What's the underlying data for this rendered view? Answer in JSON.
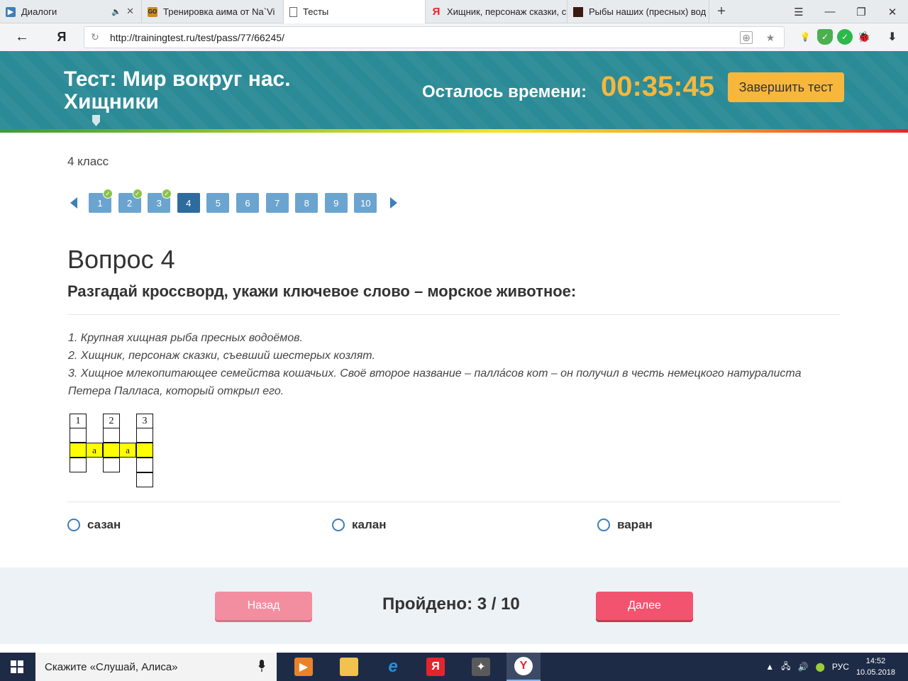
{
  "browser": {
    "tabs": [
      {
        "label": "Диалоги",
        "favicon_color": "#3f7fb8"
      },
      {
        "label": "Тренировка аима от Na`Vi",
        "favicon_color": "#c98a2a"
      },
      {
        "label": "Тесты",
        "favicon_color": "#888888"
      },
      {
        "label": "Хищник, персонаж сказки, с",
        "favicon_color": "#e3262c"
      },
      {
        "label": "Рыбы наших (пресных) вод",
        "favicon_color": "#3a1a10"
      }
    ],
    "new_tab_symbol": "+",
    "url": "http://trainingtest.ru/test/pass/77/66245/",
    "yandex_letter": "Я"
  },
  "header": {
    "title": "Тест: Мир вокруг нас. Хищники",
    "time_label": "Осталось времени:",
    "timer": "00:35:45",
    "finish_button": "Завершить тест"
  },
  "grade": "4 класс",
  "pager": {
    "pages": [
      "1",
      "2",
      "3",
      "4",
      "5",
      "6",
      "7",
      "8",
      "9",
      "10"
    ],
    "answered": [
      1,
      2,
      3
    ],
    "current": 4
  },
  "question": {
    "heading": "Вопрос 4",
    "text": "Разгадай кроссворд, укажи ключевое слово – морское животное:",
    "clues": [
      "1. Крупная хищная рыба пресных водоёмов.",
      "2. Хищник, персонаж сказки, съевший шестерых козлят.",
      "3. Хищное млекопитающее семейства кошачьих. Своё второе название – палла́сов кот – он получил в честь немецкого натуралиста Петера Палласа, который открыл его."
    ],
    "crossword": {
      "numbers": [
        "1",
        "2",
        "3"
      ],
      "letters": [
        "а",
        "а"
      ],
      "highlight_color": "#ffff00"
    }
  },
  "answers": [
    {
      "label": "сазан"
    },
    {
      "label": "калан"
    },
    {
      "label": "варан"
    }
  ],
  "footer": {
    "back_button": "Назад",
    "progress": "Пройдено: 3 / 10",
    "next_button": "Далее"
  },
  "taskbar": {
    "search_placeholder": "Скажите «Слушай, Алиса»",
    "language": "РУС",
    "time": "14:52",
    "date": "10.05.2018"
  },
  "colors": {
    "banner": "#2a8a95",
    "timer": "#f6b73c",
    "page_button": "#6ba5cf",
    "page_current": "#2e6c9f",
    "check": "#8bc34a",
    "next_button": "#f2546f",
    "back_button": "#f28ea0"
  }
}
